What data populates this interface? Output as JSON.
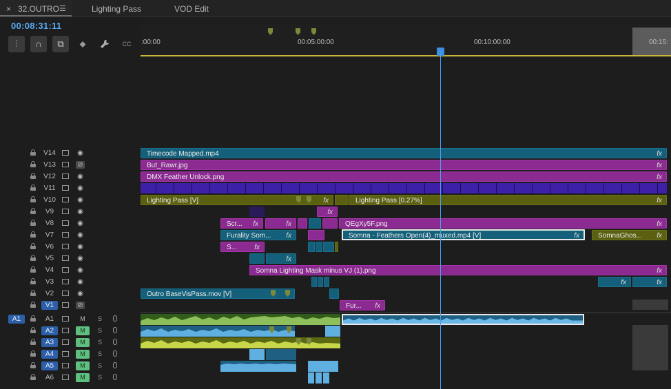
{
  "tabs": [
    {
      "label": "32.OUTRO",
      "close": "×",
      "menu": "☰"
    },
    {
      "label": "Lighting Pass"
    },
    {
      "label": "VOD Edit"
    }
  ],
  "timecode": "00:08:31:11",
  "tools": [
    {
      "name": "insert-sequence-nest",
      "glyph": "⫶"
    },
    {
      "name": "snap",
      "glyph": "∩"
    },
    {
      "name": "linked-selection",
      "glyph": "⧉"
    },
    {
      "name": "add-marker",
      "glyph": "⬥"
    },
    {
      "name": "timeline-settings-wrench",
      "glyph": "🔧"
    },
    {
      "name": "captions",
      "glyph": "CC"
    }
  ],
  "ruler": {
    "labels": [
      ":00:00",
      "00:05:00:00",
      "00:10:00:00",
      "00:15:"
    ]
  },
  "video_tracks": [
    {
      "name": "V14",
      "target": false,
      "eye_off": false
    },
    {
      "name": "V13",
      "target": false,
      "eye_off": true
    },
    {
      "name": "V12",
      "target": false,
      "eye_off": false
    },
    {
      "name": "V11",
      "target": false,
      "eye_off": false
    },
    {
      "name": "V10",
      "target": false,
      "eye_off": false
    },
    {
      "name": "V9",
      "target": false,
      "eye_off": false
    },
    {
      "name": "V8",
      "target": false,
      "eye_off": false
    },
    {
      "name": "V7",
      "target": false,
      "eye_off": false
    },
    {
      "name": "V6",
      "target": false,
      "eye_off": false
    },
    {
      "name": "V5",
      "target": false,
      "eye_off": false
    },
    {
      "name": "V4",
      "target": false,
      "eye_off": false
    },
    {
      "name": "V3",
      "target": false,
      "eye_off": false
    },
    {
      "name": "V2",
      "target": false,
      "eye_off": false
    },
    {
      "name": "V1",
      "target": true,
      "eye_off": true
    }
  ],
  "audio_tracks": [
    {
      "name": "A1",
      "target": false,
      "mute": "M",
      "mute_on": false,
      "solo": "S"
    },
    {
      "name": "A2",
      "target": true,
      "mute": "M",
      "mute_on": true,
      "solo": "S"
    },
    {
      "name": "A3",
      "target": true,
      "mute": "M",
      "mute_on": true,
      "solo": "S"
    },
    {
      "name": "A4",
      "target": true,
      "mute": "M",
      "mute_on": true,
      "solo": "S"
    },
    {
      "name": "A5",
      "target": true,
      "mute": "M",
      "mute_on": true,
      "solo": "S"
    },
    {
      "name": "A6",
      "target": false,
      "mute": "M",
      "mute_on": true,
      "solo": "S"
    }
  ],
  "source_patch": "A1",
  "clips": {
    "v14": "Timecode Mapped.mp4",
    "v13": "But_Rawr.jpg",
    "v12": "DMX Feather Unlock.png",
    "v10a": "Lighting Pass [V]",
    "v10b": "Lighting Pass [0.27%]",
    "v8a": "Scr...",
    "v8b": "QEgXy5F.png",
    "v7a": "Furality Som...",
    "v7b": "Somna - Feathers Open(4)_muxed.mp4 [V]",
    "v7c": "SomnaGhos...",
    "v6a": "S...",
    "v4": "Somna Lighting Mask minus VJ (1).png",
    "v2": "Outro BaseVisPass.mov [V]",
    "v1": "Fur...",
    "fx": "fx"
  },
  "colors": {
    "video_teal": "#14607a",
    "video_purple": "#8b2a90",
    "video_olive": "#5b5f10",
    "audio_green": "#325c1a",
    "audio_blue": "#1e5f82",
    "playhead": "#4a9ff0",
    "timecode": "#5aa9f0"
  }
}
